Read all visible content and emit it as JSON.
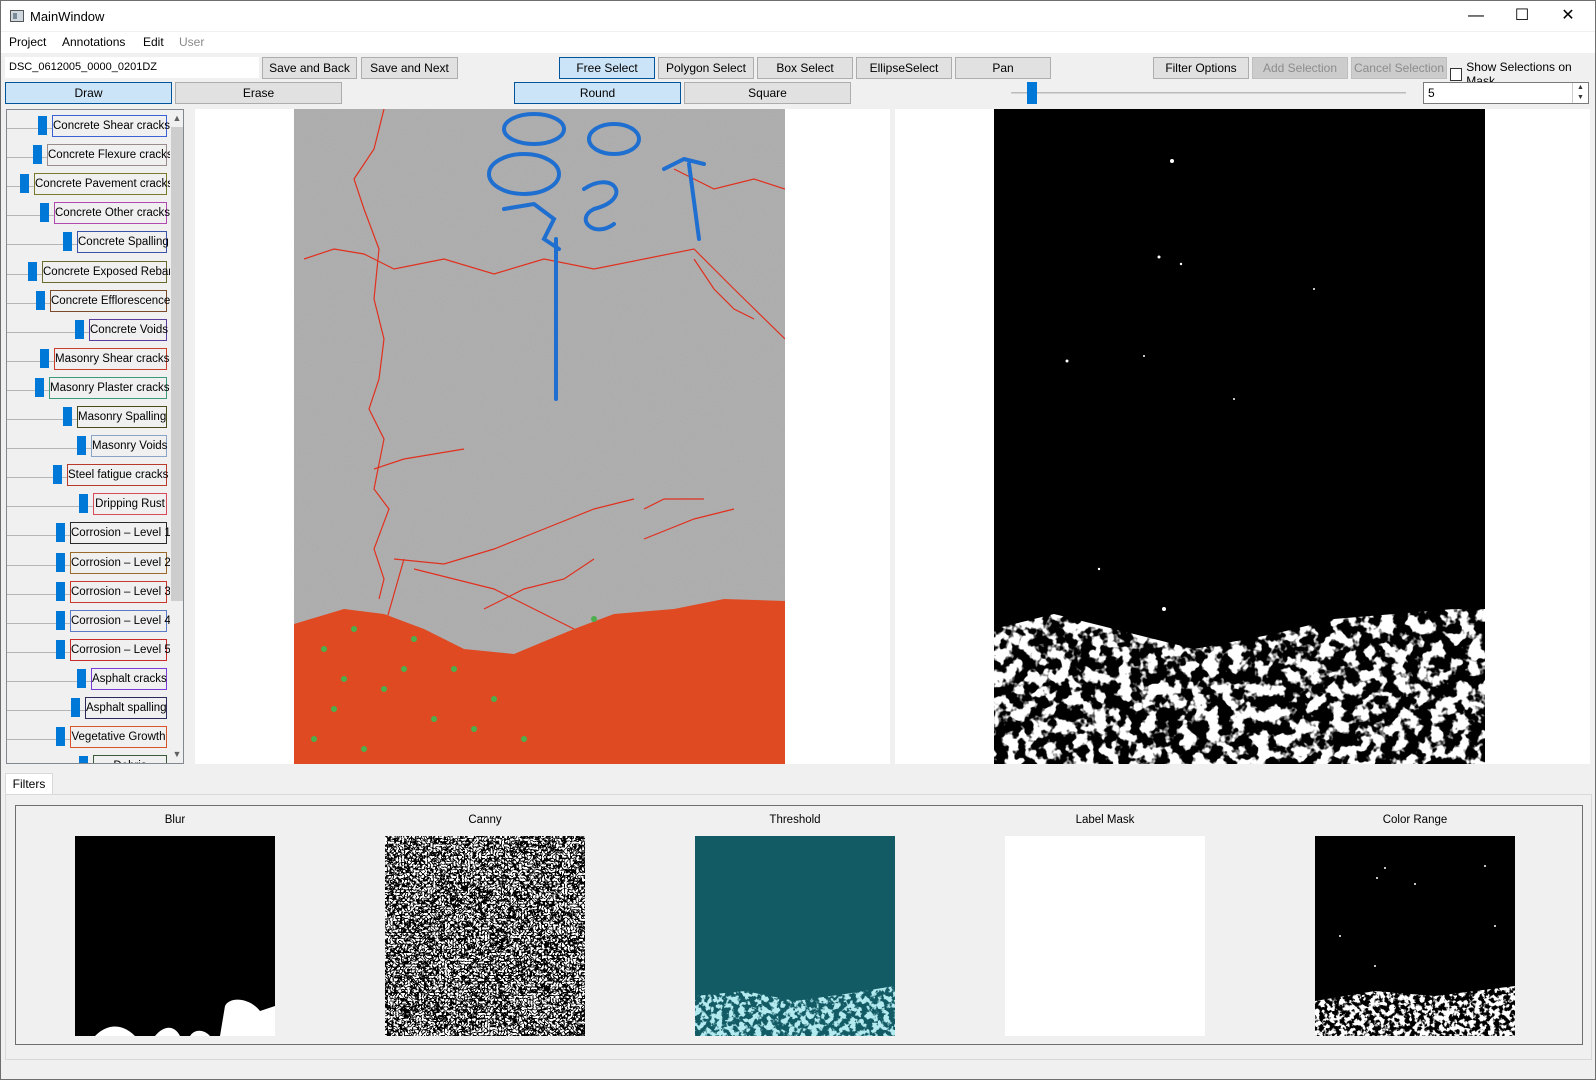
{
  "window": {
    "title": "MainWindow",
    "minimize_glyph": "—",
    "maximize_glyph": "☐",
    "close_glyph": "✕"
  },
  "menu": {
    "items": [
      "Project",
      "Annotations",
      "Edit",
      "User"
    ]
  },
  "toolbar": {
    "filename": "DSC_0612005_0000_0201DZ",
    "save_back": "Save and Back",
    "save_next": "Save and Next",
    "free_select": "Free Select",
    "polygon_select": "Polygon Select",
    "box_select": "Box Select",
    "ellipse_select": "EllipseSelect",
    "pan": "Pan",
    "filter_options": "Filter Options",
    "add_selection": "Add Selection",
    "cancel_selection": "Cancel Selection",
    "show_selections": "Show Selections on Mask"
  },
  "tools": {
    "draw": "Draw",
    "erase": "Erase",
    "round": "Round",
    "square": "Square",
    "brush_size": "5",
    "brush_slider_fraction": 0.04
  },
  "labels": [
    {
      "name": "Concrete Shear cracks",
      "color": "#3a62d6"
    },
    {
      "name": "Concrete Flexure cracks",
      "color": "#9a8c8c"
    },
    {
      "name": "Concrete Pavement cracks",
      "color": "#7a7a2a"
    },
    {
      "name": "Concrete Other cracks",
      "color": "#b04ab0"
    },
    {
      "name": "Concrete Spalling",
      "color": "#3a52a8"
    },
    {
      "name": "Concrete Exposed Rebar",
      "color": "#6a6a2a"
    },
    {
      "name": "Concrete Efflorescence",
      "color": "#7a4a2a"
    },
    {
      "name": "Concrete Voids",
      "color": "#5a3a9a"
    },
    {
      "name": "Masonry  Shear cracks",
      "color": "#c8402a"
    },
    {
      "name": "Masonry  Plaster cracks",
      "color": "#3a9a7a"
    },
    {
      "name": "Masonry  Spalling",
      "color": "#4a4a1a"
    },
    {
      "name": "Masonry Voids",
      "color": "#8aa4c8"
    },
    {
      "name": "Steel fatigue cracks",
      "color": "#b83a2a"
    },
    {
      "name": "Dripping Rust",
      "color": "#d84a5a"
    },
    {
      "name": "Corrosion – Level 1",
      "color": "#2a2a2a"
    },
    {
      "name": "Corrosion – Level 2",
      "color": "#9a6a2a"
    },
    {
      "name": "Corrosion – Level 3",
      "color": "#c83a2a"
    },
    {
      "name": "Corrosion – Level 4",
      "color": "#5a7ac8"
    },
    {
      "name": "Corrosion – Level 5",
      "color": "#c82a2a"
    },
    {
      "name": "Asphalt cracks",
      "color": "#7a3ad8"
    },
    {
      "name": "Asphalt spalling",
      "color": "#2a2a5a"
    },
    {
      "name": "Vegetative Growth",
      "color": "#d8542a"
    },
    {
      "name": "Debris",
      "color": "#3a5a3a"
    }
  ],
  "filters": {
    "tab_label": "Filters",
    "titles": [
      "Blur",
      "Canny",
      "Threshold",
      "Label Mask",
      "Color Range"
    ]
  }
}
